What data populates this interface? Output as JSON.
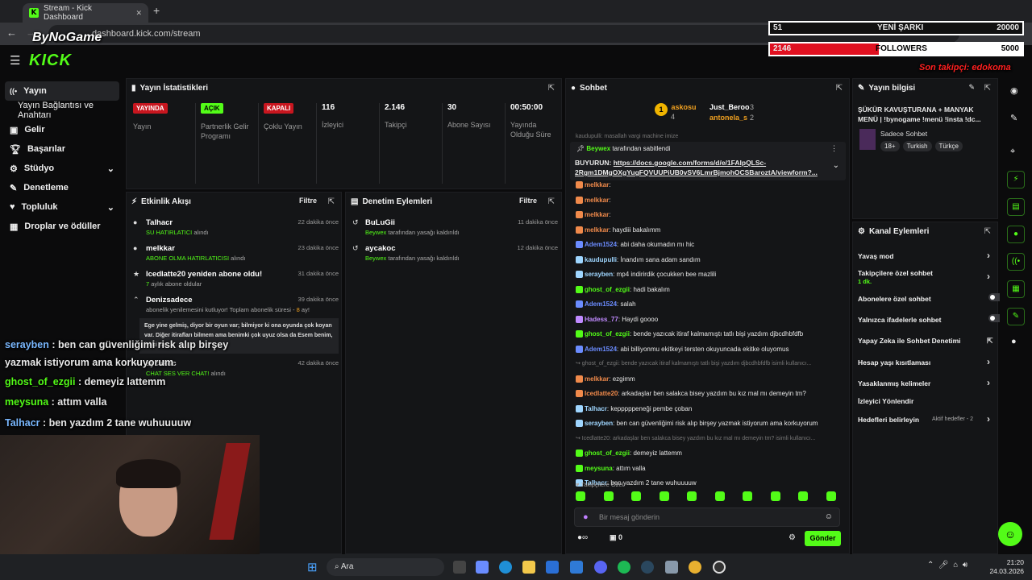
{
  "browser": {
    "tab_title": "Stream - Kick Dashboard",
    "url": "dashboard.kick.com/stream",
    "add_tab": "+",
    "close_tab": "✕"
  },
  "app": {
    "logo": "KICK"
  },
  "sidebar": {
    "items": [
      {
        "label": "Yayın",
        "icon": "broadcast-icon"
      },
      {
        "label": "Yayın Bağlantısı ve Anahtarı"
      },
      {
        "label": "Gelir",
        "icon": "dollar-icon"
      },
      {
        "label": "Başarılar",
        "icon": "trophy-icon"
      },
      {
        "label": "Stüdyo",
        "icon": "studio-icon"
      },
      {
        "label": "Denetleme",
        "icon": "wrench-icon"
      },
      {
        "label": "Topluluk",
        "icon": "community-icon"
      },
      {
        "label": "Droplar ve ödüller",
        "icon": "drops-icon"
      }
    ]
  },
  "stats": {
    "title": "Yayın İstatistikleri",
    "items": [
      {
        "tag": "YAYINDA",
        "label": "Yayın",
        "color": "#e0202f"
      },
      {
        "tag": "AÇIK",
        "label": "Partnerlik Gelir Programı",
        "color": "#53fc18"
      },
      {
        "tag": "KAPALI",
        "label": "Çoklu Yayın",
        "color": "#e0202f"
      },
      {
        "value": "116",
        "label": "İzleyici"
      },
      {
        "value": "2.146",
        "label": "Takipçi"
      },
      {
        "value": "30",
        "label": "Abone Sayısı"
      },
      {
        "value": "00:50:00",
        "label": "Yayında Olduğu Süre"
      }
    ]
  },
  "activity": {
    "title": "Etkinlik Akışı",
    "filter": "Filtre",
    "events": [
      {
        "name": "Talhacr",
        "sub": "SU HATIRLATICI",
        "sub2": "alındı",
        "time": "22 dakika önce"
      },
      {
        "name": "melkkar",
        "sub": "ABONE OLMA HATIRLATICISI",
        "sub2": "alındı",
        "time": "23 dakika önce"
      },
      {
        "name": "Icedlatte20 yeniden abone oldu!",
        "sub": "7",
        "sub2": "aylık abone oldular",
        "time": "31 dakika önce"
      },
      {
        "name": "Denizsadece",
        "sub": "abonelik yenilemesini kutluyor! Toplam abonelik süresi -",
        "sub2": "8",
        "sub3": "ay!",
        "time": "39 dakika önce",
        "message": "Ege yine gelmiş, diyor bir oyun var; bilmiyor ki ona oyunda çok koyan var. Diğer itirafları bilmem ama benimki çok uyuz olsa da Esem benim, iyi ki var"
      },
      {
        "name": "aycakoc",
        "sub": "CHAT SES VER CHAT!",
        "sub2": "alındı",
        "time": "42 dakika önce"
      }
    ]
  },
  "moderation": {
    "title": "Denetim Eylemleri",
    "filter": "Filtre",
    "events": [
      {
        "name": "BuLuGii",
        "by": "Beywex",
        "action": "tarafından yasağı kaldırıldı",
        "time": "11 dakika önce"
      },
      {
        "name": "aycakoc",
        "by": "Beywex",
        "action": "tarafından yasağı kaldırıldı",
        "time": "12 dakika önce"
      }
    ]
  },
  "chat": {
    "title": "Sohbet",
    "leaders": [
      {
        "rank": "1",
        "name": "askosu",
        "count": "4"
      },
      {
        "name": "Just_Beroo",
        "count": "3"
      },
      {
        "name": "antonela_s",
        "count": "2"
      }
    ],
    "truncated_top": "kaudupulli: masallah vargi machine imize",
    "pinned": {
      "by": "Beywex",
      "by_text": "tarafından sabitlendi",
      "prefix": "BUYURUN:",
      "link1": "https://docs.google.com/forms/d/e/1FAIpQLSc-",
      "link2": "2Rgm1DMgOXgYugFQVUUPiUB0vSV6LmrBjmohOCSBaroztA/viewform?..."
    },
    "messages": [
      {
        "user": "melkkar",
        "color": "#f08a4b",
        "text": ""
      },
      {
        "user": "melkkar",
        "color": "#f08a4b",
        "text": ""
      },
      {
        "user": "melkkar",
        "color": "#f08a4b",
        "text": ""
      },
      {
        "user": "melkkar",
        "color": "#f08a4b",
        "text": "haydiii bakalımm"
      },
      {
        "user": "Adem1524",
        "color": "#6b8cff",
        "text": "abi daha okumadın mı hic"
      },
      {
        "user": "kaudupulli",
        "color": "#9fd6ff",
        "text": "İnandım sana adam sandım"
      },
      {
        "user": "serayben",
        "color": "#9fd6ff",
        "text": "mp4 indirirdik çocukken bee mazlili"
      },
      {
        "user": "ghost_of_ezgii",
        "color": "#53fc18",
        "text": "hadi bakalım"
      },
      {
        "user": "Adem1524",
        "color": "#6b8cff",
        "text": "salah"
      },
      {
        "user": "Hadess_77",
        "color": "#c08aff",
        "text": "Haydi goooo"
      },
      {
        "user": "ghost_of_ezgii",
        "color": "#53fc18",
        "text": "bende yazıcak itiraf kalmamıştı tatlı bişi yazdım djbcdhbfdfb"
      },
      {
        "user": "Adem1524",
        "color": "#6b8cff",
        "text": "abi billiyonmu ekitkeyi tersten okuyuncada ekitke oluyomus"
      },
      {
        "user": "",
        "color": "#888",
        "text": "↪ ghost_of_ezgii: bende yazıcak itiraf kalmamıştı tatlı bişi yazdım djbcdhbfdfb isimli kullanıcı..."
      },
      {
        "user": "melkkar",
        "color": "#f08a4b",
        "text": "ezgimm"
      },
      {
        "user": "Icedlatte20",
        "color": "#f08a4b",
        "text": "arkadaşlar ben salakca bisey yazdım bu kız mal mı demeyin tm?"
      },
      {
        "user": "Talhacr",
        "color": "#9fd6ff",
        "text": "kepppppeneği pembe çoban"
      },
      {
        "user": "serayben",
        "color": "#9fd6ff",
        "text": "ben can güvenliğimi risk alıp birşey yazmak istiyorum ama korkuyorum"
      },
      {
        "user": "",
        "color": "#888",
        "text": "↪ Icedlatte20: arkadaşlar ben salakca bisey yazdım bu kız mal mı demeyin tm? isimli kullanıcı..."
      },
      {
        "user": "ghost_of_ezgii",
        "color": "#53fc18",
        "text": "demeyiz lattemm"
      },
      {
        "user": "meysuna",
        "color": "#53fc18",
        "text": "attım valla"
      },
      {
        "user": "Talhacr",
        "color": "#9fd6ff",
        "text": "ben yazdım 2 tane wuhuuuuw"
      }
    ],
    "followers_only": "Takipçilere Özel",
    "placeholder": "Bir mesaj gönderin",
    "send": "Gönder",
    "count": "0"
  },
  "info": {
    "title": "Yayın bilgisi",
    "stream_title": "ŞÜKÜR KAVUŞTURANA + MANYAK MENÜ | !bynogame !menü !insta !dc...",
    "category": "Sadece Sohbet",
    "tags": [
      "18+",
      "Turkish",
      "Türkçe"
    ]
  },
  "channel": {
    "title": "Kanal Eylemleri",
    "items": [
      {
        "label": "Yavaş mod",
        "kind": "arrow"
      },
      {
        "label": "Takipçilere özel sohbet",
        "sub": "1 dk.",
        "kind": "arrow"
      },
      {
        "label": "Abonelere özel sohbet",
        "kind": "toggle"
      },
      {
        "label": "Yalnızca ifadelerle sohbet",
        "kind": "toggle"
      },
      {
        "label": "Yapay Zeka ile Sohbet Denetimi",
        "kind": "ext"
      },
      {
        "label": "Hesap yaşı kısıtlaması",
        "kind": "arrow"
      },
      {
        "label": "Yasaklanmış kelimeler",
        "kind": "arrow"
      },
      {
        "label": "İzleyici Yönlendir",
        "kind": "none"
      },
      {
        "label": "Hedefleri belirleyin",
        "kind": "arrow",
        "extra": "Aktif hedefler - 2"
      }
    ]
  },
  "overlay": {
    "goal1": {
      "left": "51",
      "center": "YENİ ŞARKI",
      "right": "20000"
    },
    "goal2": {
      "left": "2146",
      "center": "FOLLOWERS",
      "right": "5000",
      "progress": 0.43
    },
    "last_follower": "Son takipçi: edokoma",
    "brand": "ByNoGame",
    "chat": [
      {
        "user": "serayben",
        "text": " : ben can güvenliğimi risk alıp birşey",
        "color": "#7ab8ff"
      },
      {
        "user": "",
        "text": "yazmak istiyorum ama korkuyorum",
        "color": "#fff"
      },
      {
        "user": "ghost_of_ezgii",
        "text": " : demeyiz lattemm",
        "color": "#53fc18"
      },
      {
        "user": "meysuna",
        "text": " : attım valla",
        "color": "#53fc18"
      },
      {
        "user": "Talhacr",
        "text": " : ben yazdım 2 tane wuhuuuuw",
        "color": "#7ab8ff"
      }
    ]
  },
  "taskbar": {
    "search": "Ara",
    "time": "21:20",
    "date": "24.03.2026"
  }
}
